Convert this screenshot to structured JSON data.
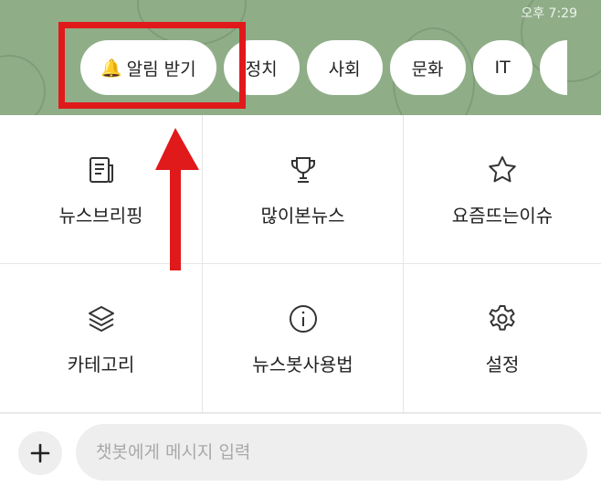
{
  "status_bar": {
    "time": "오후 7:29"
  },
  "chips": [
    {
      "label": "알림 받기",
      "icon": "bell-icon"
    },
    {
      "label": "정치"
    },
    {
      "label": "사회"
    },
    {
      "label": "문화"
    },
    {
      "label": "IT"
    }
  ],
  "menu": [
    {
      "label": "뉴스브리핑",
      "icon": "newspaper-icon"
    },
    {
      "label": "많이본뉴스",
      "icon": "trophy-icon"
    },
    {
      "label": "요즘뜨는이슈",
      "icon": "star-icon"
    },
    {
      "label": "카테고리",
      "icon": "layers-icon"
    },
    {
      "label": "뉴스봇사용법",
      "icon": "info-icon"
    },
    {
      "label": "설정",
      "icon": "gear-icon"
    }
  ],
  "composer": {
    "placeholder": "챗봇에게 메시지 입력",
    "plus_icon": "plus-icon"
  },
  "colors": {
    "header_bg": "#8fae88",
    "highlight": "#e0191b"
  }
}
